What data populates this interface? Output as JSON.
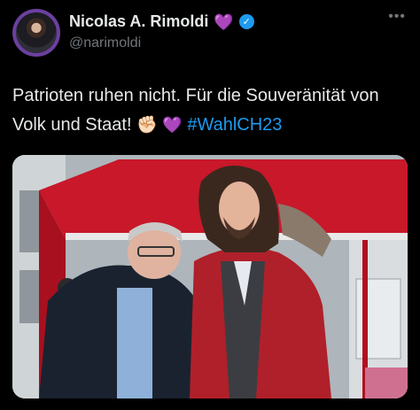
{
  "author": {
    "name": "Nicolas A. Rimoldi",
    "name_emoji": "💜",
    "handle": "@narimoldi",
    "verified_icon": "verified-badge-icon",
    "avatar_ring_color": "#6b3fa0"
  },
  "more_menu": "•••",
  "tweet": {
    "text": "Patrioten ruhen nicht. Für die Souveränität von Volk und Staat!",
    "emoji_1": "✊🏻",
    "emoji_2": "💜",
    "hashtag": "#WahlCH23"
  },
  "colors": {
    "background": "#000000",
    "text": "#e7e9ea",
    "secondary": "#71767b",
    "link": "#1d9bf0",
    "tent_red": "#c8182a"
  },
  "media": {
    "icon": "photo-icon"
  }
}
